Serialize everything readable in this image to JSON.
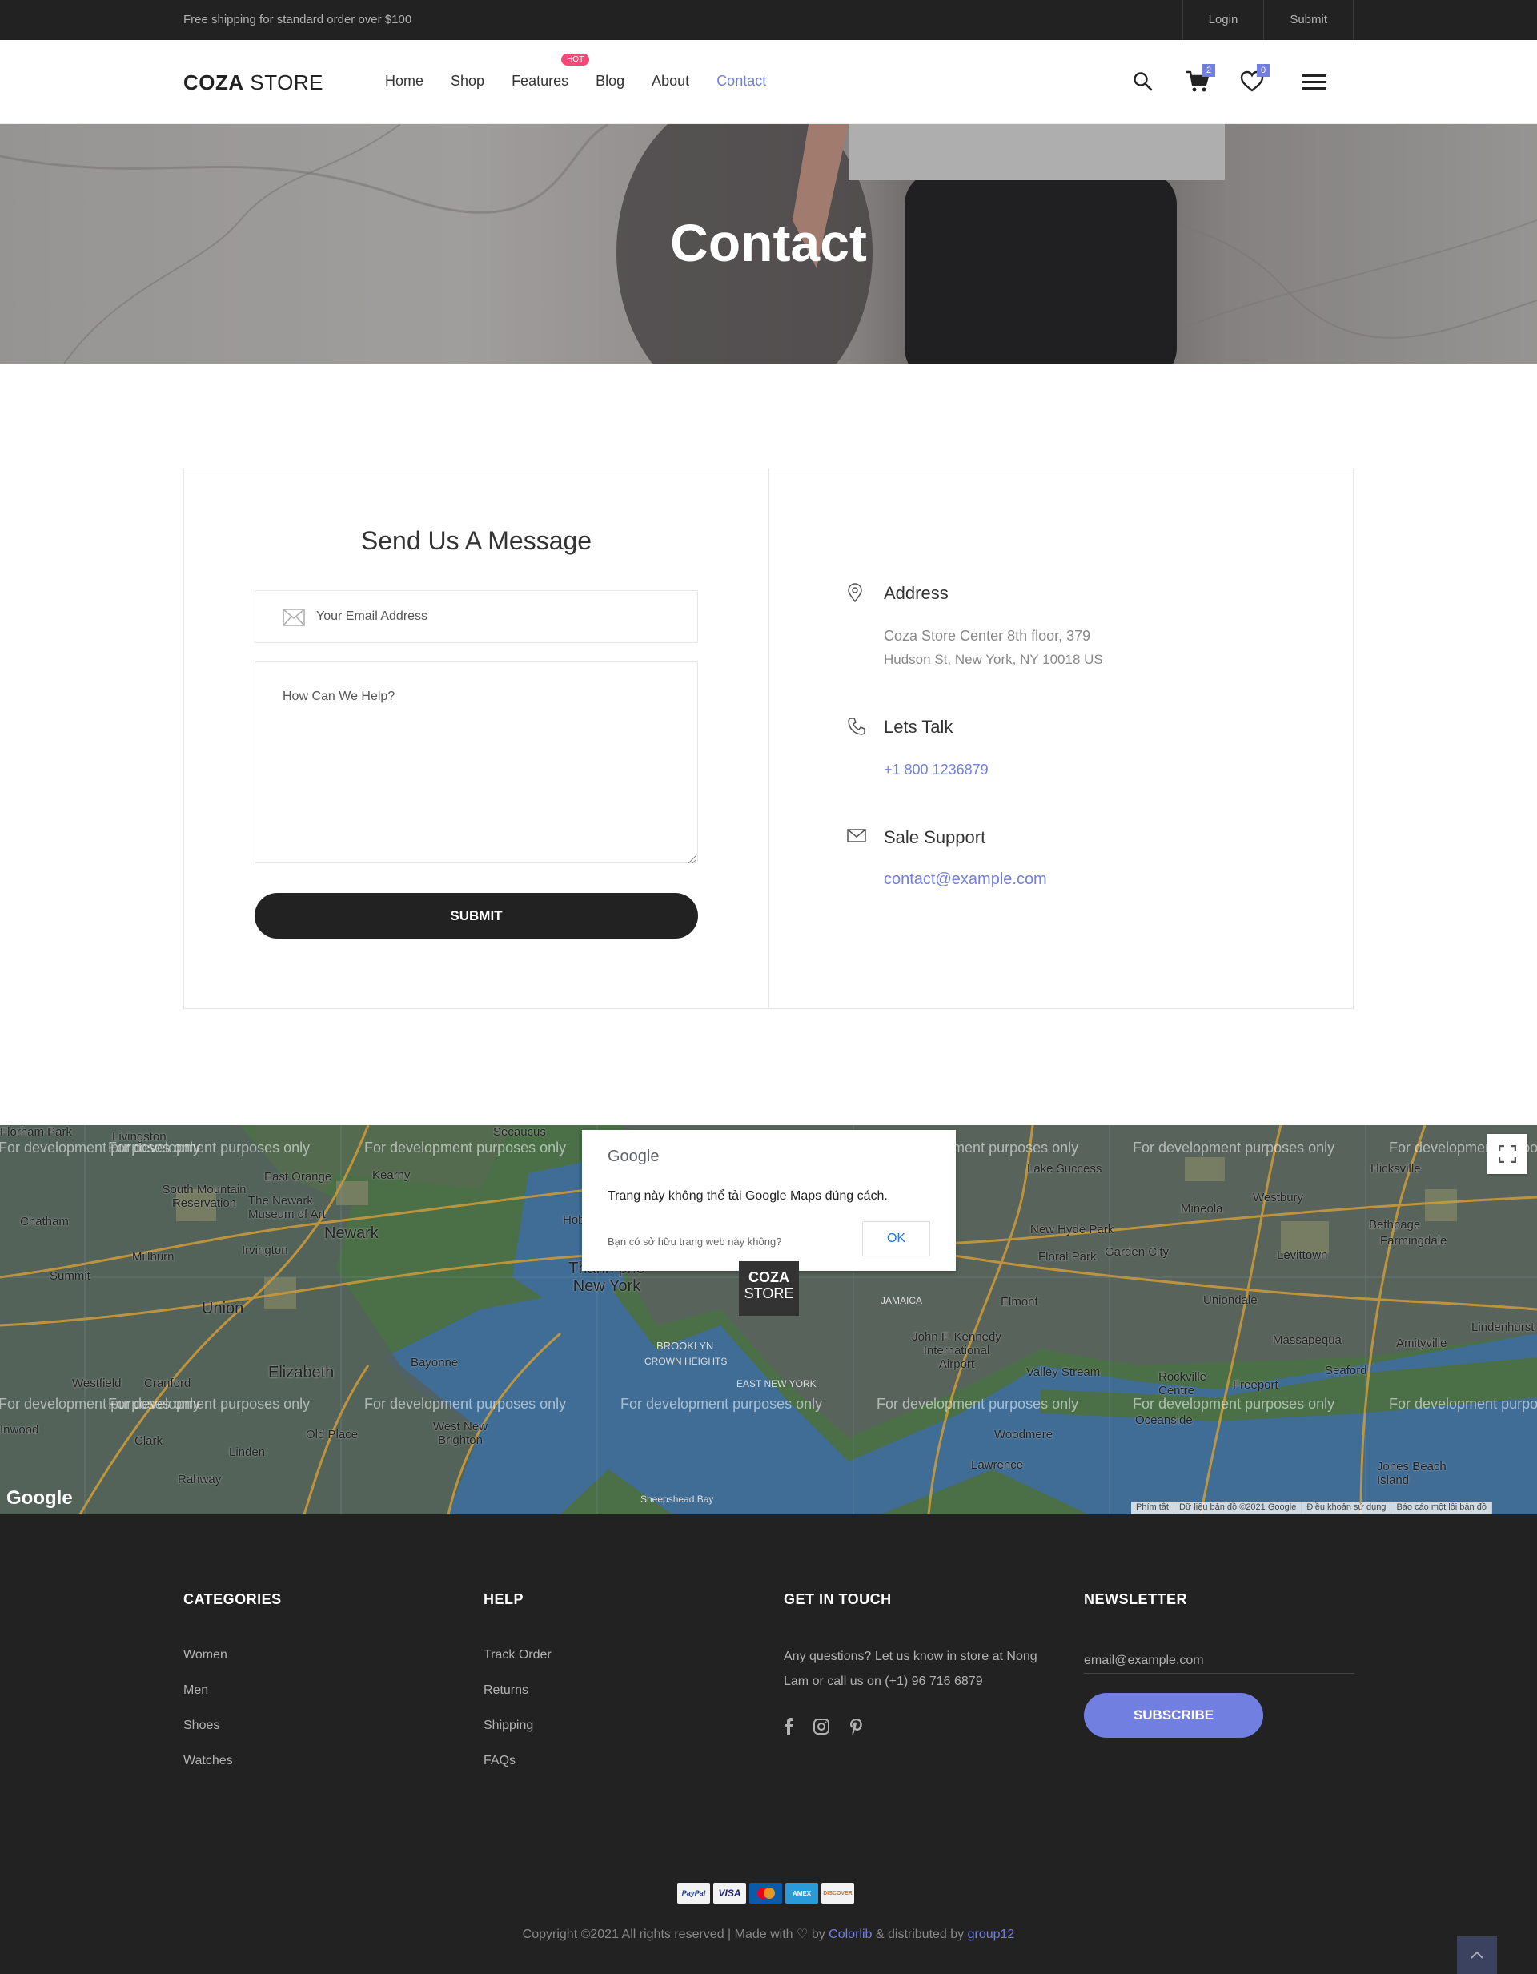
{
  "topbar": {
    "shipping_text": "Free shipping for standard order over $100",
    "login": "Login",
    "submit": "Submit"
  },
  "header": {
    "logo_bold": "COZA",
    "logo_rest": " STORE",
    "nav": [
      {
        "label": "Home"
      },
      {
        "label": "Shop"
      },
      {
        "label": "Features",
        "badge": "HOT"
      },
      {
        "label": "Blog"
      },
      {
        "label": "About"
      },
      {
        "label": "Contact",
        "active": true
      }
    ],
    "cart_count": "2",
    "wishlist_count": "0",
    "icons": [
      "search-icon",
      "cart-icon",
      "heart-icon",
      "menu-icon"
    ]
  },
  "banner": {
    "title": "Contact"
  },
  "form": {
    "title": "Send Us A Message",
    "email_placeholder": "Your Email Address",
    "message_placeholder": "How Can We Help?",
    "submit_label": "SUBMIT"
  },
  "info": {
    "address_label": "Address",
    "address_line1": "Coza Store Center 8th floor, 379",
    "address_line2": "Hudson St, New York, NY 10018 US",
    "talk_label": "Lets Talk",
    "phone": "+1 800 1236879",
    "support_label": "Sale Support",
    "email": "contact@example.com"
  },
  "map": {
    "watermark": "For development purposes only",
    "dialog_logo": "Google",
    "dialog_message": "Trang này không thể tải Google Maps đúng cách.",
    "dialog_question": "Bạn có sở hữu trang web này không?",
    "dialog_ok": "OK",
    "pin_line1": "COZA",
    "pin_line2": "STORE",
    "google_mark": "Google",
    "footer_links": [
      "Phím tắt",
      "Dữ liệu bản đồ ©2021 Google",
      "Điều khoản sử dụng",
      "Báo cáo một lỗi bản đồ"
    ],
    "places": [
      {
        "name": "Florham Park"
      },
      {
        "name": "Livingston"
      },
      {
        "name": "East Orange"
      },
      {
        "name": "Kearny"
      },
      {
        "name": "South Mountain Reservation"
      },
      {
        "name": "The Newark Museum of Art"
      },
      {
        "name": "Newark"
      },
      {
        "name": "Chatham"
      },
      {
        "name": "Irvington"
      },
      {
        "name": "Millburn"
      },
      {
        "name": "Summit"
      },
      {
        "name": "Union"
      },
      {
        "name": "Hoboken"
      },
      {
        "name": "Thành phố New York"
      },
      {
        "name": "Elizabeth"
      },
      {
        "name": "Bayonne"
      },
      {
        "name": "Westfield"
      },
      {
        "name": "Cranford"
      },
      {
        "name": "Clark"
      },
      {
        "name": "Linden"
      },
      {
        "name": "Rahway"
      },
      {
        "name": "Old Place"
      },
      {
        "name": "West New Brighton"
      },
      {
        "name": "BROOKLYN"
      },
      {
        "name": "CROWN HEIGHTS"
      },
      {
        "name": "EAST NEW YORK"
      },
      {
        "name": "JAMAICA"
      },
      {
        "name": "Elmont"
      },
      {
        "name": "John F. Kennedy International Airport"
      },
      {
        "name": "Valley Stream"
      },
      {
        "name": "Lake Success"
      },
      {
        "name": "New Hyde Park"
      },
      {
        "name": "Floral Park"
      },
      {
        "name": "Garden City"
      },
      {
        "name": "Mineola"
      },
      {
        "name": "Westbury"
      },
      {
        "name": "Hicksville"
      },
      {
        "name": "Bethpage"
      },
      {
        "name": "Levittown"
      },
      {
        "name": "Farmingdale"
      },
      {
        "name": "Uniondale"
      },
      {
        "name": "Massapequa"
      },
      {
        "name": "Amityville"
      },
      {
        "name": "Seaford"
      },
      {
        "name": "Rockville Centre"
      },
      {
        "name": "Freeport"
      },
      {
        "name": "Oceanside"
      },
      {
        "name": "Woodmere"
      },
      {
        "name": "Lawrence"
      },
      {
        "name": "Jones Beach Island"
      },
      {
        "name": "Lindenhurst"
      },
      {
        "name": "Secaucus"
      },
      {
        "name": "Sheepshead Bay"
      },
      {
        "name": "Inwood"
      }
    ]
  },
  "footer": {
    "categories_title": "CATEGORIES",
    "categories": [
      "Women",
      "Men",
      "Shoes",
      "Watches"
    ],
    "help_title": "HELP",
    "help": [
      "Track Order",
      "Returns",
      "Shipping",
      "FAQs"
    ],
    "touch_title": "GET IN TOUCH",
    "touch_text": "Any questions? Let us know in store at Nong Lam or call us on (+1) 96 716 6879",
    "social": [
      "facebook-icon",
      "instagram-icon",
      "pinterest-icon"
    ],
    "newsletter_title": "NEWSLETTER",
    "newsletter_placeholder": "email@example.com",
    "subscribe_label": "SUBSCRIBE",
    "payments": [
      "PayPal",
      "VISA",
      "MC",
      "AMEX",
      "DISCOVER"
    ],
    "copyright_prefix": "Copyright ©2021 All rights reserved | Made with",
    "copyright_by": "by",
    "colorlib": "Colorlib",
    "distributed": "& distributed by",
    "group": "group12"
  },
  "colors": {
    "accent": "#717fe0",
    "dark": "#222222",
    "hot": "#f74877"
  }
}
